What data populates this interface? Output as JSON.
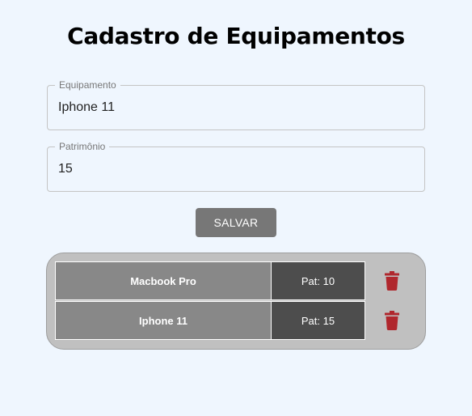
{
  "title": "Cadastro de Equipamentos",
  "form": {
    "equipamento": {
      "label": "Equipamento",
      "value": "Iphone 11"
    },
    "patrimonio": {
      "label": "Patrimônio",
      "value": "15"
    },
    "save_label": "SALVAR"
  },
  "items": [
    {
      "name": "Macbook Pro",
      "pat": "Pat: 10",
      "delete_icon": "trash-icon"
    },
    {
      "name": "Iphone 11",
      "pat": "Pat: 15",
      "delete_icon": "trash-icon"
    }
  ],
  "colors": {
    "background": "#eff6fe",
    "save_button": "#777777",
    "list_panel": "#c0c0c0",
    "name_cell": "#888888",
    "pat_cell": "#4d4d4d",
    "delete_icon": "#b0272d"
  }
}
